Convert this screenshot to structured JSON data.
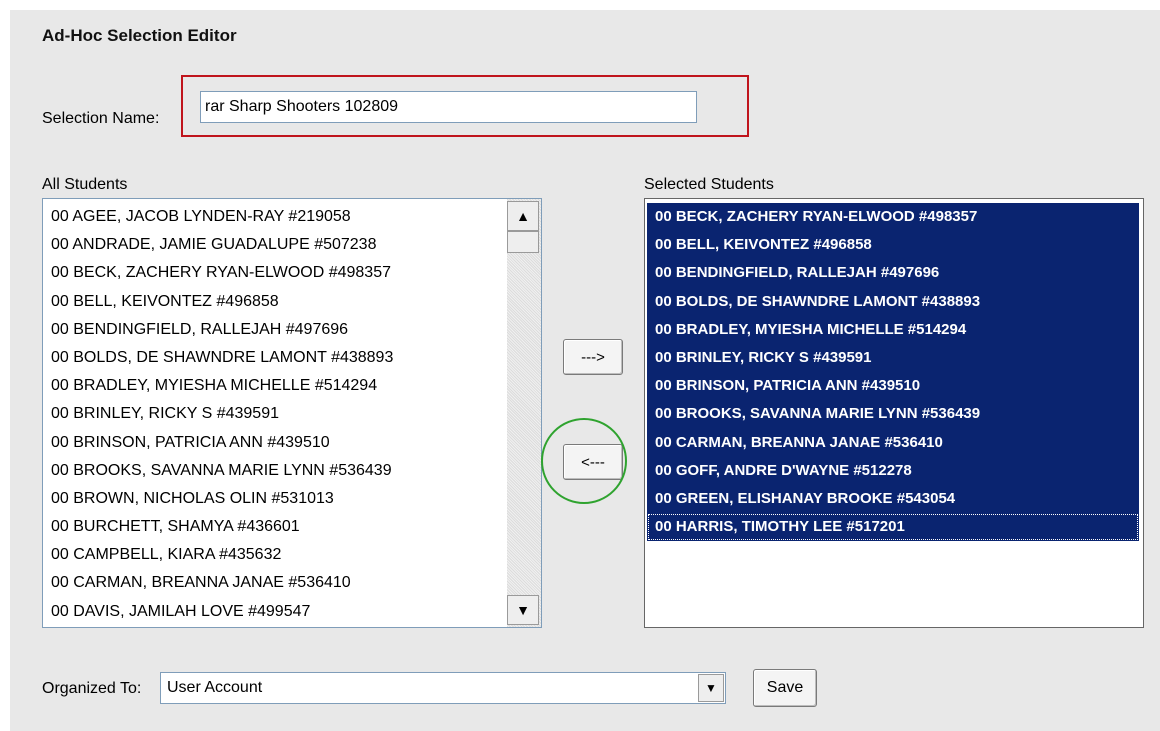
{
  "page": {
    "title": "Ad-Hoc Selection Editor"
  },
  "selection": {
    "name_label": "Selection Name:",
    "name_value": "rar Sharp Shooters 102809"
  },
  "all_students": {
    "label": "All Students",
    "items": [
      "00 AGEE, JACOB LYNDEN-RAY #219058",
      "00 ANDRADE, JAMIE GUADALUPE #507238",
      "00 BECK, ZACHERY RYAN-ELWOOD #498357",
      "00 BELL, KEIVONTEZ  #496858",
      "00 BENDINGFIELD, RALLEJAH  #497696",
      "00 BOLDS, DE SHAWNDRE LAMONT #438893",
      "00 BRADLEY, MYIESHA MICHELLE #514294",
      "00 BRINLEY, RICKY S #439591",
      "00 BRINSON, PATRICIA ANN #439510",
      "00 BROOKS, SAVANNA MARIE LYNN #536439",
      "00 BROWN, NICHOLAS OLIN #531013",
      "00 BURCHETT, SHAMYA  #436601",
      "00 CAMPBELL, KIARA  #435632",
      "00 CARMAN, BREANNA JANAE #536410",
      "00 DAVIS, JAMILAH LOVE #499547"
    ]
  },
  "selected_students": {
    "label": "Selected Students",
    "items": [
      "00 BECK, ZACHERY RYAN-ELWOOD #498357",
      "00 BELL, KEIVONTEZ  #496858",
      "00 BENDINGFIELD, RALLEJAH  #497696",
      "00 BOLDS, DE SHAWNDRE LAMONT #438893",
      "00 BRADLEY, MYIESHA MICHELLE #514294",
      "00 BRINLEY, RICKY S #439591",
      "00 BRINSON, PATRICIA ANN #439510",
      "00 BROOKS, SAVANNA MARIE LYNN #536439",
      "00 CARMAN, BREANNA JANAE #536410",
      "00 GOFF, ANDRE D'WAYNE #512278",
      "00 GREEN, ELISHANAY BROOKE #543054",
      "00 HARRIS, TIMOTHY LEE #517201"
    ]
  },
  "buttons": {
    "add": "--->",
    "remove": "<---",
    "save": "Save"
  },
  "organized_to": {
    "label": "Organized To:",
    "value": "User Account"
  },
  "icons": {
    "scroll_up": "up-arrow-icon",
    "scroll_down": "down-arrow-icon",
    "dropdown": "chevron-down-icon"
  },
  "colors": {
    "selection_highlight": "#0a2470",
    "annotation_red": "#c0141c",
    "annotation_green": "#2fa32f"
  }
}
